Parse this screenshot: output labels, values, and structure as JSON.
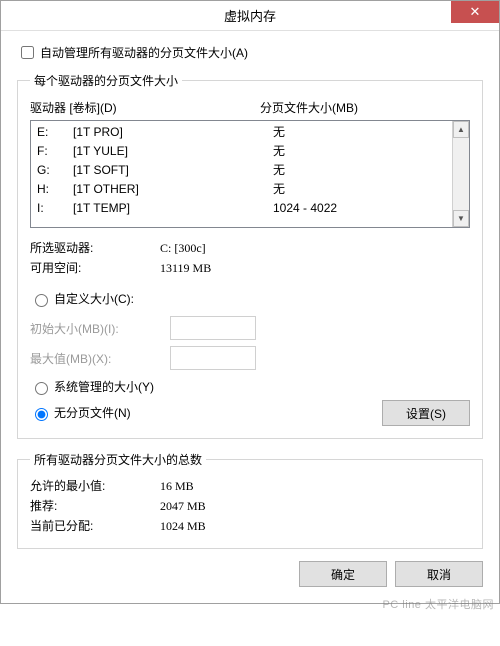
{
  "title": "虚拟内存",
  "auto_manage": {
    "label": "自动管理所有驱动器的分页文件大小(A)",
    "checked": false
  },
  "per_drive": {
    "legend": "每个驱动器的分页文件大小",
    "col_drive": "驱动器 [卷标](D)",
    "col_page": "分页文件大小(MB)",
    "rows": [
      {
        "letter": "E:",
        "label": "[1T PRO]",
        "page": "无"
      },
      {
        "letter": "F:",
        "label": "[1T YULE]",
        "page": "无"
      },
      {
        "letter": "G:",
        "label": "[1T SOFT]",
        "page": "无"
      },
      {
        "letter": "H:",
        "label": "[1T OTHER]",
        "page": "无"
      },
      {
        "letter": "I:",
        "label": "[1T TEMP]",
        "page": "1024 - 4022"
      }
    ],
    "selected_drive_label": "所选驱动器:",
    "selected_drive_value": "C:  [300c]",
    "free_space_label": "可用空间:",
    "free_space_value": "13119 MB",
    "custom_size_label": "自定义大小(C):",
    "initial_label": "初始大小(MB)(I):",
    "max_label": "最大值(MB)(X):",
    "system_managed_label": "系统管理的大小(Y)",
    "no_paging_label": "无分页文件(N)",
    "set_button": "设置(S)",
    "size_mode": "none"
  },
  "totals": {
    "legend": "所有驱动器分页文件大小的总数",
    "min_label": "允许的最小值:",
    "min_value": "16 MB",
    "rec_label": "推荐:",
    "rec_value": "2047 MB",
    "cur_label": "当前已分配:",
    "cur_value": "1024 MB"
  },
  "buttons": {
    "ok": "确定",
    "cancel": "取消"
  },
  "watermark": "PC  line 太平洋电脑网"
}
